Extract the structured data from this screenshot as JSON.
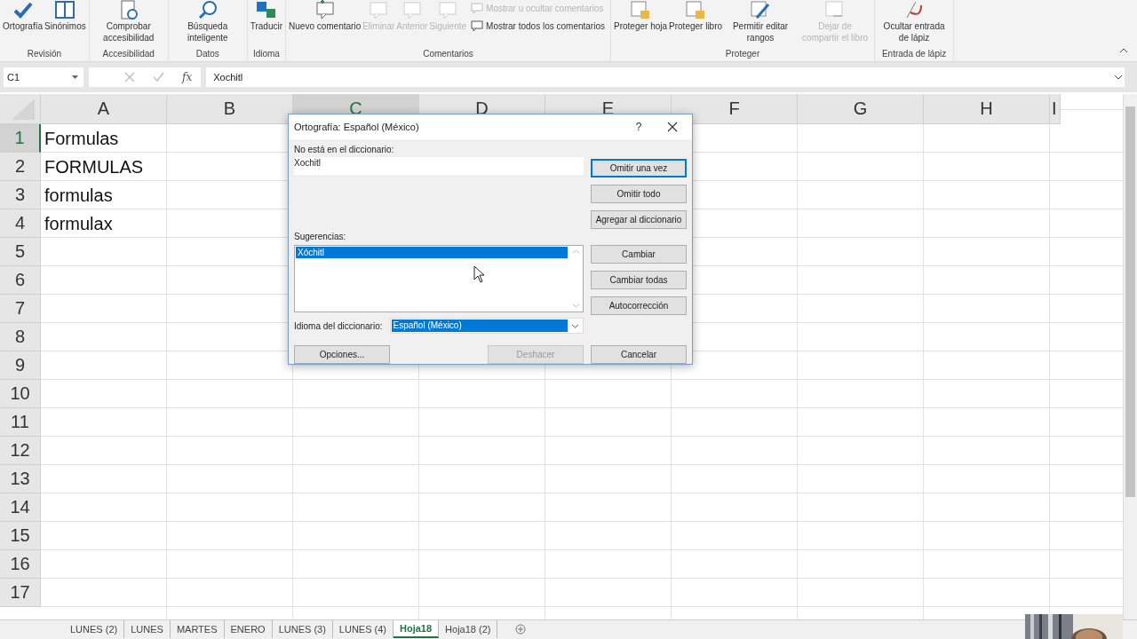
{
  "ribbon": {
    "groups": [
      {
        "label": "Revisión",
        "buttons": [
          {
            "label": "Ortografía",
            "kind": "large",
            "disabled": false
          },
          {
            "label": "Sinónimos",
            "kind": "large",
            "disabled": false
          }
        ]
      },
      {
        "label": "Accesibilidad",
        "buttons": [
          {
            "label": "Comprobar accesibilidad",
            "kind": "large",
            "disabled": false
          }
        ]
      },
      {
        "label": "Datos",
        "buttons": [
          {
            "label": "Búsqueda inteligente",
            "kind": "large",
            "disabled": false
          }
        ]
      },
      {
        "label": "Idioma",
        "buttons": [
          {
            "label": "Traducir",
            "kind": "large",
            "disabled": false
          }
        ]
      },
      {
        "label": "Comentarios",
        "buttons": [
          {
            "label": "Nuevo comentario",
            "kind": "large",
            "disabled": false
          },
          {
            "label": "Eliminar",
            "kind": "large",
            "disabled": true
          },
          {
            "label": "Anterior",
            "kind": "large",
            "disabled": true
          },
          {
            "label": "Siguiente",
            "kind": "large",
            "disabled": true
          },
          {
            "label": "Mostrar u ocultar comentarios",
            "kind": "small",
            "disabled": true
          },
          {
            "label": "Mostrar todos los comentarios",
            "kind": "small",
            "disabled": false
          }
        ]
      },
      {
        "label": "Proteger",
        "buttons": [
          {
            "label": "Proteger hoja",
            "kind": "large",
            "disabled": false
          },
          {
            "label": "Proteger libro",
            "kind": "large",
            "disabled": false
          },
          {
            "label": "Permitir editar rangos",
            "kind": "large",
            "disabled": false
          },
          {
            "label": "Dejar de compartir el libro",
            "kind": "large",
            "disabled": true
          }
        ]
      },
      {
        "label": "Entrada de lápiz",
        "buttons": [
          {
            "label": "Ocultar entrada de lápiz",
            "kind": "large",
            "disabled": false
          }
        ]
      }
    ]
  },
  "formula_bar": {
    "name_box": "C1",
    "fx": "fx",
    "value": "Xochitl"
  },
  "sheet": {
    "columns": [
      {
        "label": "A",
        "selected": false
      },
      {
        "label": "B",
        "selected": false
      },
      {
        "label": "C",
        "selected": true
      },
      {
        "label": "D",
        "selected": false
      },
      {
        "label": "E",
        "selected": false
      },
      {
        "label": "F",
        "selected": false
      },
      {
        "label": "G",
        "selected": false
      },
      {
        "label": "H",
        "selected": false
      },
      {
        "label": "I",
        "selected": false
      }
    ],
    "rows": [
      {
        "header": "1",
        "selected": true,
        "cells": [
          "Formulas"
        ]
      },
      {
        "header": "2",
        "selected": false,
        "cells": [
          "FORMULAS"
        ]
      },
      {
        "header": "3",
        "selected": false,
        "cells": [
          "formulas"
        ]
      },
      {
        "header": "4",
        "selected": false,
        "cells": [
          "formulax"
        ]
      },
      {
        "header": "5",
        "selected": false,
        "cells": []
      },
      {
        "header": "6",
        "selected": false,
        "cells": []
      },
      {
        "header": "7",
        "selected": false,
        "cells": []
      },
      {
        "header": "8",
        "selected": false,
        "cells": []
      },
      {
        "header": "9",
        "selected": false,
        "cells": []
      },
      {
        "header": "10",
        "selected": false,
        "cells": []
      },
      {
        "header": "11",
        "selected": false,
        "cells": []
      },
      {
        "header": "12",
        "selected": false,
        "cells": []
      },
      {
        "header": "13",
        "selected": false,
        "cells": []
      },
      {
        "header": "14",
        "selected": false,
        "cells": []
      },
      {
        "header": "15",
        "selected": false,
        "cells": []
      },
      {
        "header": "16",
        "selected": false,
        "cells": []
      },
      {
        "header": "17",
        "selected": false,
        "cells": []
      }
    ]
  },
  "sheet_tabs": [
    {
      "label": "LUNES (2)",
      "selected": false
    },
    {
      "label": "LUNES",
      "selected": false
    },
    {
      "label": "MARTES",
      "selected": false
    },
    {
      "label": "ENERO",
      "selected": false
    },
    {
      "label": "LUNES (3)",
      "selected": false
    },
    {
      "label": "LUNES (4)",
      "selected": false
    },
    {
      "label": "Hoja18",
      "selected": true
    },
    {
      "label": "Hoja18 (2)",
      "selected": false
    }
  ],
  "dialog": {
    "title": "Ortografía: Español (México)",
    "help": "?",
    "not_in_dictionary_label": "No está en el diccionario:",
    "not_in_dictionary_value": "Xochitl",
    "suggestions_label": "Sugerencias:",
    "suggestions": [
      {
        "label": "Xóchitl",
        "selected": true
      }
    ],
    "language_label": "Idioma del diccionario:",
    "language_value": "Español (México)",
    "side_buttons": [
      {
        "label": "Omitir una vez",
        "default": true,
        "disabled": false
      },
      {
        "label": "Omitir todo",
        "default": false,
        "disabled": false
      },
      {
        "label": "Agregar al diccionario",
        "default": false,
        "disabled": false
      },
      {
        "label": "Cambiar",
        "default": false,
        "disabled": false
      },
      {
        "label": "Cambiar todas",
        "default": false,
        "disabled": false
      },
      {
        "label": "Autocorrección",
        "default": false,
        "disabled": false
      }
    ],
    "bottom_buttons": [
      {
        "label": "Opciones...",
        "default": false,
        "disabled": false
      },
      {
        "label": "Deshacer",
        "default": false,
        "disabled": true
      },
      {
        "label": "Cancelar",
        "default": false,
        "disabled": false
      }
    ]
  }
}
